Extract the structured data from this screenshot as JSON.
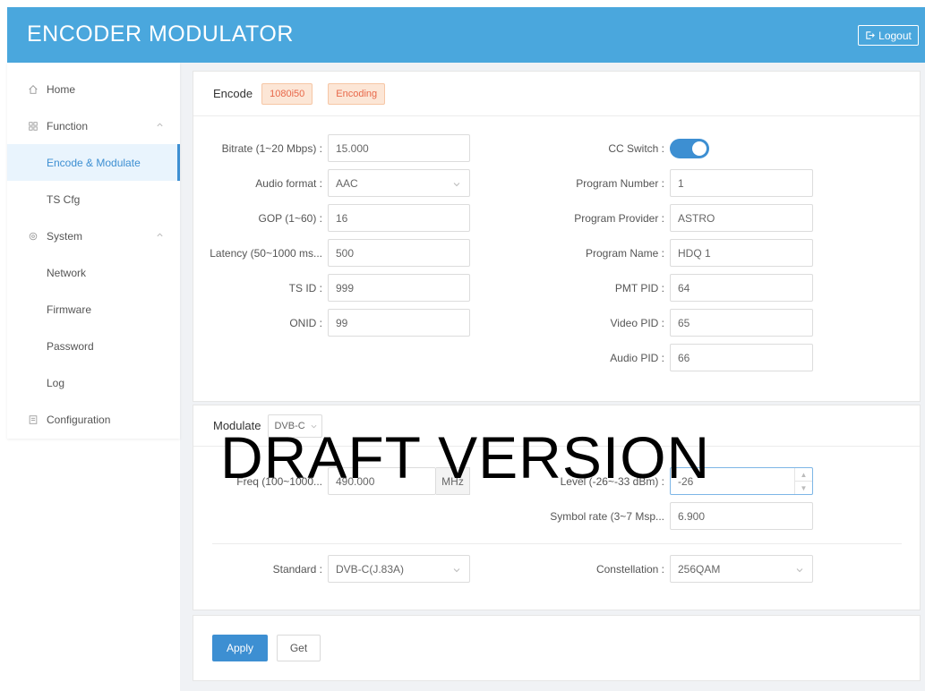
{
  "app": {
    "title": "ENCODER MODULATOR",
    "logout_label": "Logout"
  },
  "sidebar": {
    "home": "Home",
    "function": "Function",
    "encode_modulate": "Encode & Modulate",
    "ts_cfg": "TS Cfg",
    "system": "System",
    "network": "Network",
    "firmware": "Firmware",
    "password": "Password",
    "log": "Log",
    "configuration": "Configuration"
  },
  "encode": {
    "title": "Encode",
    "resolution_tag": "1080i50",
    "status_tag": "Encoding",
    "bitrate_label": "Bitrate (1~20 Mbps) :",
    "bitrate_value": "15.000",
    "audio_format_label": "Audio format :",
    "audio_format_value": "AAC",
    "gop_label": "GOP (1~60) :",
    "gop_value": "16",
    "latency_label": "Latency (50~1000 ms...",
    "latency_value": "500",
    "ts_id_label": "TS ID :",
    "ts_id_value": "999",
    "onid_label": "ONID :",
    "onid_value": "99",
    "cc_switch_label": "CC Switch :",
    "cc_switch_on": true,
    "program_number_label": "Program Number :",
    "program_number_value": "1",
    "program_provider_label": "Program Provider :",
    "program_provider_value": "ASTRO",
    "program_name_label": "Program Name :",
    "program_name_value": "HDQ 1",
    "pmt_pid_label": "PMT PID :",
    "pmt_pid_value": "64",
    "video_pid_label": "Video PID :",
    "video_pid_value": "65",
    "audio_pid_label": "Audio PID :",
    "audio_pid_value": "66"
  },
  "modulate": {
    "title": "Modulate",
    "mode_value": "DVB-C",
    "freq_label": "Freq (100~1000...",
    "freq_value": "490.000",
    "freq_unit": "MHz",
    "level_label": "Level (-26~-33 dBm) :",
    "level_value": "-26",
    "symbol_rate_label": "Symbol rate (3~7 Msp...",
    "symbol_rate_value": "6.900",
    "standard_label": "Standard :",
    "standard_value": "DVB-C(J.83A)",
    "constellation_label": "Constellation :",
    "constellation_value": "256QAM"
  },
  "actions": {
    "apply": "Apply",
    "get": "Get"
  },
  "watermark": "DRAFT VERSION",
  "colors": {
    "header": "#4aa7dd",
    "accent": "#3d8fd2",
    "tag_text": "#e8684a",
    "tag_bg": "#fce6d6"
  }
}
